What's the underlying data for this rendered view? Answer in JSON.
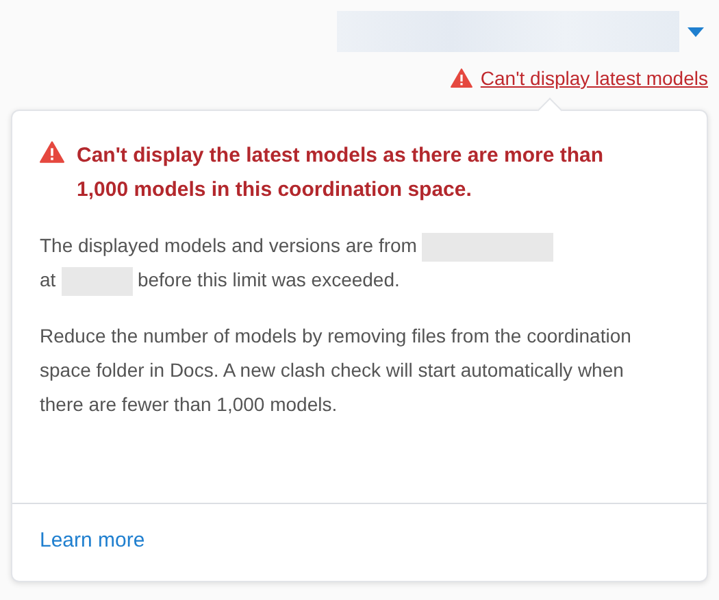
{
  "warning_link": "Can't display latest models",
  "popover": {
    "title": "Can't display the latest models as there are more than 1,000 models in this coordination space.",
    "paragraph_1_parts": [
      "The displayed models and versions are from",
      "at",
      "before this limit was exceeded."
    ],
    "paragraph_2": "Reduce the number of models by removing files from the coordination space folder in Docs. A new clash check will start automatically when there are fewer than 1,000 models.",
    "link": "Learn more"
  }
}
